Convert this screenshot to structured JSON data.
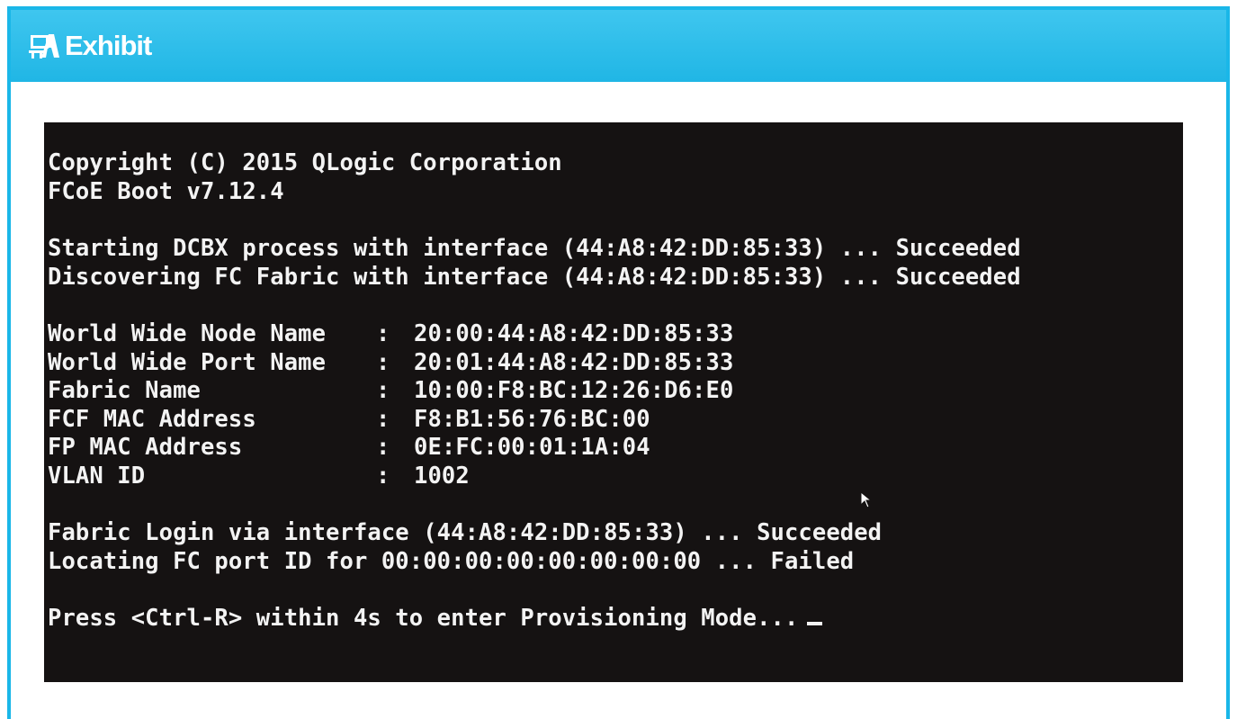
{
  "window": {
    "title": "Exhibit",
    "title_icon": "exhibit-logo-icon",
    "accent_color": "#1ab7e8"
  },
  "terminal": {
    "background_color": "#151212",
    "text_color": "#f3f3f3",
    "copyright": "Copyright (C) 2015 QLogic Corporation",
    "version": "FCoE Boot v7.12.4",
    "dcbx_line": "Starting DCBX process with interface (44:A8:42:DD:85:33) ... Succeeded",
    "discover_line": "Discovering FC Fabric with interface (44:A8:42:DD:85:33) ... Succeeded",
    "fields": [
      {
        "label": "World Wide Node Name",
        "value": "20:00:44:A8:42:DD:85:33"
      },
      {
        "label": "World Wide Port Name",
        "value": "20:01:44:A8:42:DD:85:33"
      },
      {
        "label": "Fabric Name",
        "value": "10:00:F8:BC:12:26:D6:E0"
      },
      {
        "label": "FCF MAC Address",
        "value": "F8:B1:56:76:BC:00"
      },
      {
        "label": "FP MAC Address",
        "value": "0E:FC:00:01:1A:04"
      },
      {
        "label": "VLAN ID",
        "value": "1002"
      }
    ],
    "separator": ":",
    "login_line": "Fabric Login via interface (44:A8:42:DD:85:33) ... Succeeded",
    "locate_line": "Locating FC port ID for 00:00:00:00:00:00:00:00 ... Failed",
    "prompt_line": "Press <Ctrl-R> within 4s to enter Provisioning Mode..."
  }
}
